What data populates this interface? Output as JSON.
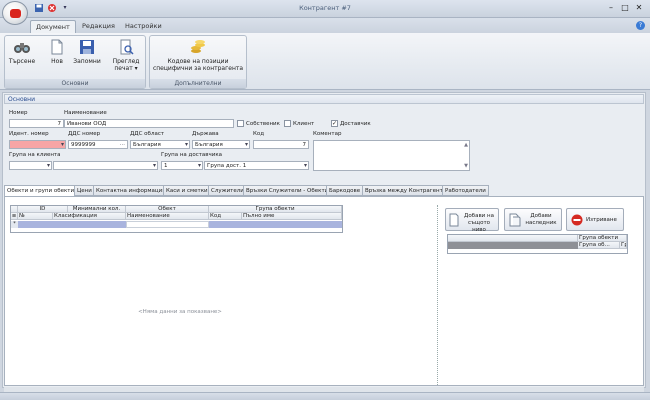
{
  "window": {
    "title": "Контрагент #7"
  },
  "ribbon": {
    "tabs": [
      "Документ",
      "Редакция",
      "Настройки"
    ],
    "groups": {
      "osnovni": {
        "title": "Основни"
      },
      "dopalnitelni": {
        "title": "Допълнителни"
      }
    },
    "buttons": {
      "search": "Търсене",
      "new": "Нов",
      "save": "Запомни",
      "preview_line1": "Преглед",
      "preview_line2": "печат",
      "codes_line1": "Кодове на позиции",
      "codes_line2": "специфични за контрагента"
    }
  },
  "section": {
    "title": "Основни"
  },
  "form": {
    "number_label": "Номер",
    "number_value": "7",
    "name_label": "Наименование",
    "name_value": "Иванови ООД",
    "owner_label": "Собственик",
    "client_label": "Клиент",
    "supplier_label": "Доставчик",
    "supplier_checked": "✓",
    "ident_label": "Идент. номер",
    "vat_label": "ДДС номер",
    "vat_value": "9999999",
    "vat_region_label": "ДДС област",
    "vat_region_value": "България",
    "country_label": "Държава",
    "country_value": "България",
    "code_label": "Код",
    "code_value": "7",
    "comment_label": "Коментар",
    "client_group_label": "Група на клиента",
    "supplier_group_label": "Група на доставчика",
    "supplier_group_num": "1",
    "supplier_group_prefix": "Група дост.",
    "supplier_group_value": "1"
  },
  "detail_tabs": [
    "Обекти и групи обекти",
    "Цени",
    "Контактна информация",
    "Каси и сметки",
    "Служители",
    "Връзки Служители - Обекти",
    "Баркодове",
    "Връзка между Контрагенти",
    "Работодатели"
  ],
  "grid": {
    "headers_row1": [
      "ID",
      "Минимални кол.",
      "Обект",
      "Група обекти"
    ],
    "headers_row2": [
      "№",
      "Класификация",
      "Наименование",
      "Код",
      "Пълно име"
    ],
    "empty_text": "<Няма данни за показване>"
  },
  "right_panel": {
    "add_same_line1": "Добави на",
    "add_same_line2": "същото ниво",
    "add_child_line1": "Добави",
    "add_child_line2": "наследник",
    "delete": "Изтриване",
    "col_header": "Група обекти",
    "col_sub": "Група об...",
    "col_sub2": "Гр"
  }
}
